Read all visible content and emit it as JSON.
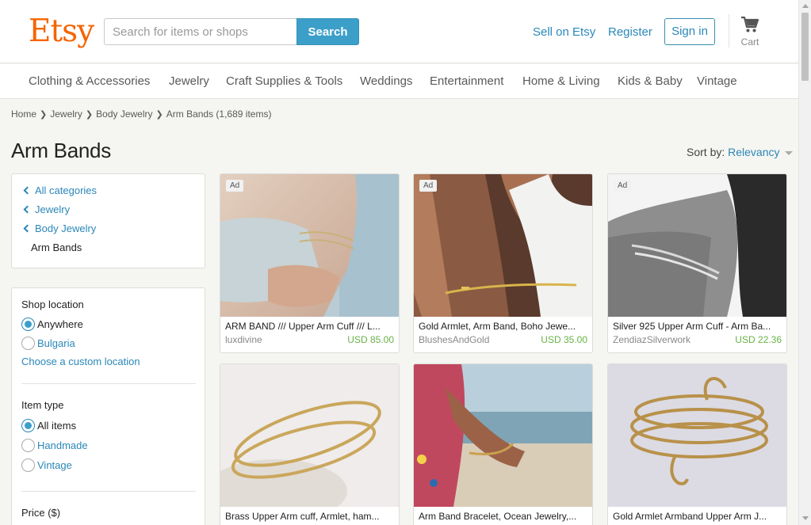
{
  "header": {
    "logo": "Etsy",
    "search_placeholder": "Search for items or shops",
    "search_button": "Search",
    "sell_link": "Sell on Etsy",
    "register_link": "Register",
    "signin_button": "Sign in",
    "cart_label": "Cart",
    "brand_color": "#f56400",
    "accent_color": "#3c9fc9"
  },
  "category_nav": [
    "Clothing & Accessories",
    "Jewelry",
    "Craft Supplies & Tools",
    "Weddings",
    "Entertainment",
    "Home & Living",
    "Kids & Baby",
    "Vintage"
  ],
  "breadcrumb": {
    "items": [
      "Home",
      "Jewelry",
      "Body Jewelry"
    ],
    "current": "Arm Bands (1,689 items)"
  },
  "page_title": "Arm Bands",
  "sort": {
    "label": "Sort by:",
    "value": "Relevancy"
  },
  "sidebar": {
    "categories": [
      "All categories",
      "Jewelry",
      "Body Jewelry"
    ],
    "current_category": "Arm Bands",
    "shop_location": {
      "heading": "Shop location",
      "options": [
        {
          "label": "Anywhere",
          "checked": true
        },
        {
          "label": "Bulgaria",
          "checked": false
        }
      ],
      "custom_link": "Choose a custom location"
    },
    "item_type": {
      "heading": "Item type",
      "options": [
        {
          "label": "All items",
          "checked": true
        },
        {
          "label": "Handmade",
          "checked": false
        },
        {
          "label": "Vintage",
          "checked": false
        }
      ]
    },
    "price_heading": "Price ($)"
  },
  "listings": [
    {
      "ad": "Ad",
      "title": "ARM BAND /// Upper Arm Cuff /// L...",
      "shop": "luxdivine",
      "price": "USD 85.00"
    },
    {
      "ad": "Ad",
      "title": "Gold Armlet, Arm Band, Boho Jewe...",
      "shop": "BlushesAndGold",
      "price": "USD 35.00"
    },
    {
      "ad": "Ad",
      "title": "Silver 925 Upper Arm Cuff - Arm Ba...",
      "shop": "ZendiazSilverwork",
      "price": "USD 22.36"
    },
    {
      "ad": "",
      "title": "Brass Upper Arm cuff, Armlet, ham...",
      "shop": "",
      "price": ""
    },
    {
      "ad": "",
      "title": "Arm Band Bracelet, Ocean Jewelry,...",
      "shop": "",
      "price": ""
    },
    {
      "ad": "",
      "title": "Gold Armlet Armband Upper Arm J...",
      "shop": "",
      "price": ""
    }
  ]
}
